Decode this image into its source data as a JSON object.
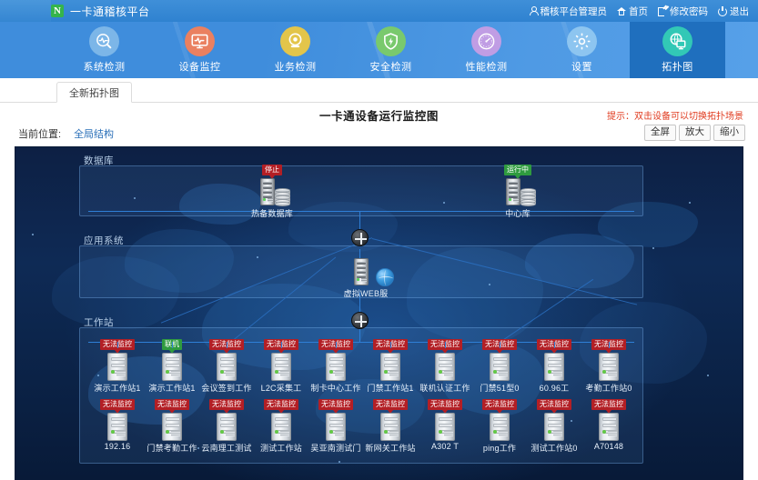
{
  "app": {
    "brand_logo": "logo-n-icon",
    "brand_title": "一卡通稽核平台",
    "user": "稽核平台管理员",
    "home": "首页",
    "change_password": "修改密码",
    "logout": "退出"
  },
  "nav": {
    "items": [
      {
        "label": "系统检测",
        "icon": "magnifier-pulse-icon",
        "color": "#7cb6e8",
        "active": false
      },
      {
        "label": "设备监控",
        "icon": "monitor-pulse-icon",
        "color": "#ea8060",
        "active": false
      },
      {
        "label": "业务检测",
        "icon": "camera-icon",
        "color": "#e3c54a",
        "active": false
      },
      {
        "label": "安全检测",
        "icon": "shield-bolt-icon",
        "color": "#79c96d",
        "active": false
      },
      {
        "label": "性能检测",
        "icon": "gauge-icon",
        "color": "#c09de4",
        "active": false
      },
      {
        "label": "设置",
        "icon": "gear-icon",
        "color": "#8dc5f0",
        "active": false
      },
      {
        "label": "拓扑图",
        "icon": "topology-icon",
        "color": "#32c8b6",
        "active": true
      }
    ]
  },
  "tabs": [
    {
      "label": "全新拓扑图",
      "active": true
    }
  ],
  "page": {
    "title": "一卡通设备运行监控图",
    "hint": "提示：双击设备可以切换拓扑场景",
    "location_label": "当前位置:",
    "location_value": "全局结构",
    "buttons": [
      {
        "label": "全屏"
      },
      {
        "label": "放大"
      },
      {
        "label": "缩小"
      }
    ]
  },
  "topology": {
    "groups": [
      {
        "name": "数据库",
        "title": "数据库"
      },
      {
        "name": "应用系统",
        "title": "应用系统"
      },
      {
        "name": "工作站",
        "title": "工作站"
      }
    ],
    "database_nodes": [
      {
        "label": "热备数据库",
        "status": "停止",
        "status_type": "stopped"
      },
      {
        "label": "中心库",
        "status": "运行中",
        "status_type": "running"
      }
    ],
    "app_nodes": [
      {
        "label": "虚拟WEB服",
        "status": "",
        "status_type": "none"
      }
    ],
    "workstations_row1": [
      {
        "label": "演示工作站1",
        "status": "无法监控",
        "status_type": "stopped"
      },
      {
        "label": "演示工作站1",
        "status": "联机",
        "status_type": "running"
      },
      {
        "label": "会议签到工作",
        "status": "无法监控",
        "status_type": "stopped"
      },
      {
        "label": "L2C采集工",
        "status": "无法监控",
        "status_type": "stopped"
      },
      {
        "label": "制卡中心工作",
        "status": "无法监控",
        "status_type": "stopped"
      },
      {
        "label": "门禁工作站1",
        "status": "无法监控",
        "status_type": "stopped"
      },
      {
        "label": "联机认证工作",
        "status": "无法监控",
        "status_type": "stopped"
      },
      {
        "label": "门禁51型0",
        "status": "无法监控",
        "status_type": "stopped"
      },
      {
        "label": "60.96工",
        "status": "无法监控",
        "status_type": "stopped"
      },
      {
        "label": "考勤工作站0",
        "status": "无法监控",
        "status_type": "stopped"
      }
    ],
    "workstations_row2": [
      {
        "label": "192.16",
        "status": "无法监控",
        "status_type": "stopped"
      },
      {
        "label": "门禁考勤工作",
        "status": "无法监控",
        "status_type": "stopped"
      },
      {
        "label": "云南理工测试",
        "status": "无法监控",
        "status_type": "stopped"
      },
      {
        "label": "测试工作站",
        "status": "无法监控",
        "status_type": "stopped"
      },
      {
        "label": "吴亚南测试门",
        "status": "无法监控",
        "status_type": "stopped"
      },
      {
        "label": "新网关工作站",
        "status": "无法监控",
        "status_type": "stopped"
      },
      {
        "label": "A302 T",
        "status": "无法监控",
        "status_type": "stopped"
      },
      {
        "label": "ping工作",
        "status": "无法监控",
        "status_type": "stopped"
      },
      {
        "label": "测试工作站0",
        "status": "无法监控",
        "status_type": "stopped"
      },
      {
        "label": "A70148",
        "status": "无法监控",
        "status_type": "stopped"
      }
    ],
    "colors": {
      "status_stopped": "#b31f25",
      "status_running": "#2f9b3f",
      "link": "#2f7fd6",
      "canvas_bg": "#0d2044",
      "group_border": "#78afeb"
    }
  }
}
